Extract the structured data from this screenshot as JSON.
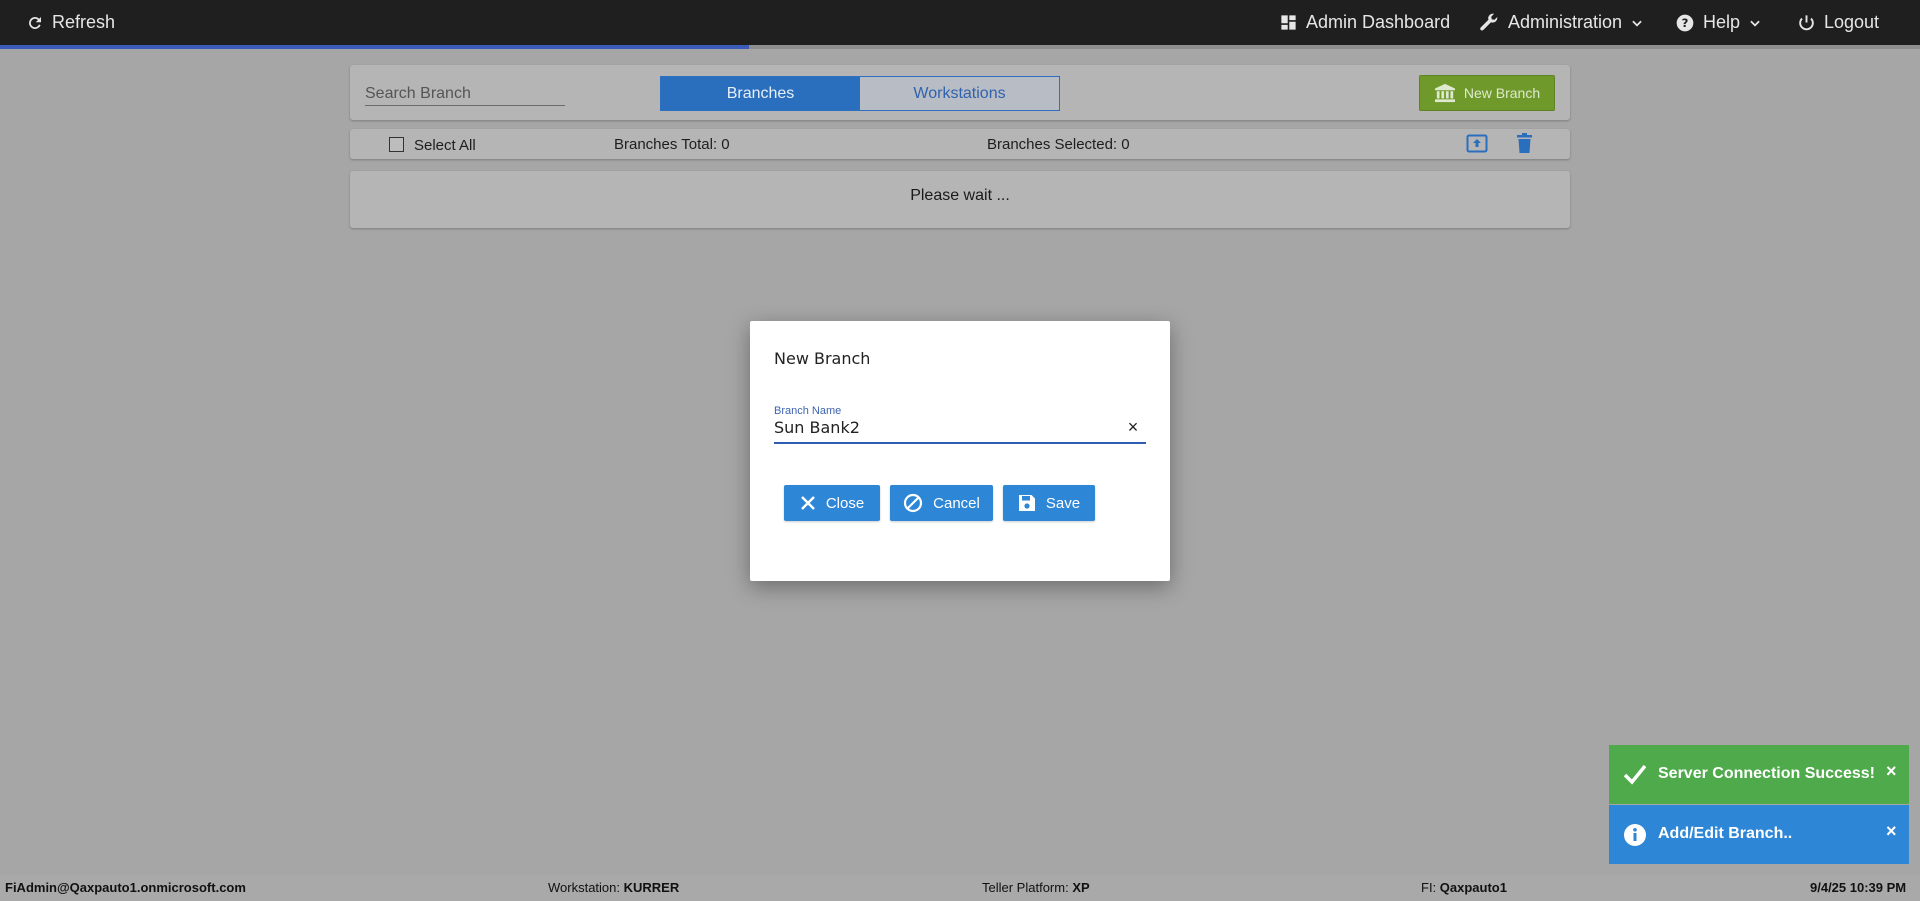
{
  "topbar": {
    "refresh": "Refresh",
    "admin_dashboard": "Admin Dashboard",
    "administration": "Administration",
    "help": "Help",
    "logout": "Logout"
  },
  "page_progress": 0.39,
  "search": {
    "placeholder": "Search Branch"
  },
  "tabs": [
    {
      "label": "Branches",
      "active": true
    },
    {
      "label": "Workstations",
      "active": false
    }
  ],
  "new_branch_button": "New Branch",
  "list_toolbar": {
    "select_all": "Select All",
    "branches_total": "Branches Total: 0",
    "branches_selected": "Branches Selected: 0"
  },
  "content_status": "Please wait ...",
  "modal": {
    "title": "New Branch",
    "field_label": "Branch Name",
    "field_value": "Sun Bank2",
    "clear": "×",
    "buttons": {
      "close": "Close",
      "cancel": "Cancel",
      "save": "Save"
    }
  },
  "toasts": [
    {
      "text": "Server Connection Success!",
      "close": "×",
      "color": "#4eaa4a"
    },
    {
      "text": "Add/Edit Branch..",
      "close": "×",
      "color": "#2e86d6"
    }
  ],
  "statusbar": {
    "user": "FiAdmin@Qaxpauto1.onmicrosoft.com",
    "workstation_label": "Workstation: ",
    "workstation_value": "KURRER",
    "platform_label": "Teller Platform: ",
    "platform_value": "XP",
    "fi_label": "FI: ",
    "fi_value": "Qaxpauto1",
    "datetime": "9/4/25 10:39 PM"
  },
  "colors": {
    "accent_blue": "#2e86d6",
    "new_branch_green": "#6f9a2b",
    "success_green": "#4eaa4a",
    "topbar": "#1f1f1f"
  }
}
